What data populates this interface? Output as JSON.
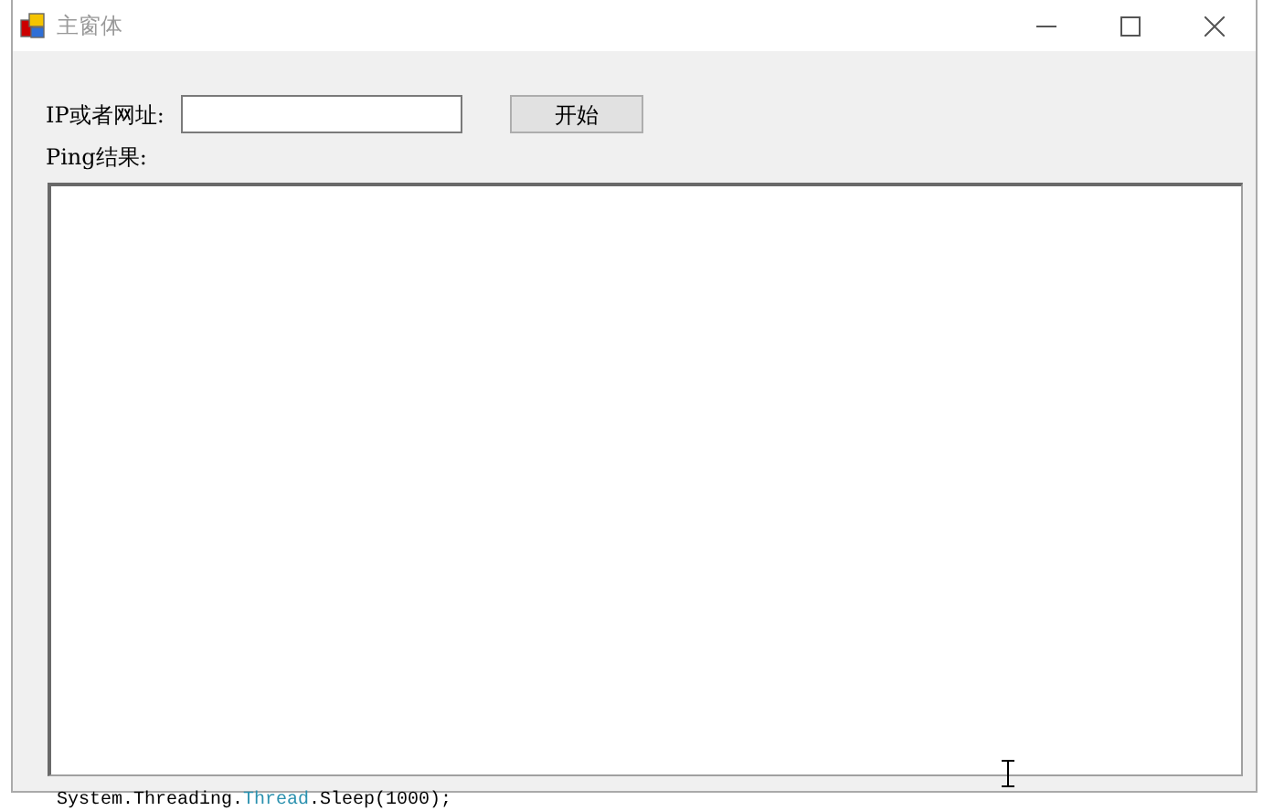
{
  "window": {
    "title": "主窗体"
  },
  "form": {
    "address_label": "IP或者网址:",
    "start_button": "开始",
    "result_label": "Ping结果:"
  },
  "background_code": {
    "tokens": [
      {
        "text": "System.Threading.",
        "kind": "plain"
      },
      {
        "text": "Thread",
        "kind": "type"
      },
      {
        "text": ".Sleep(1000);",
        "kind": "plain"
      }
    ]
  }
}
